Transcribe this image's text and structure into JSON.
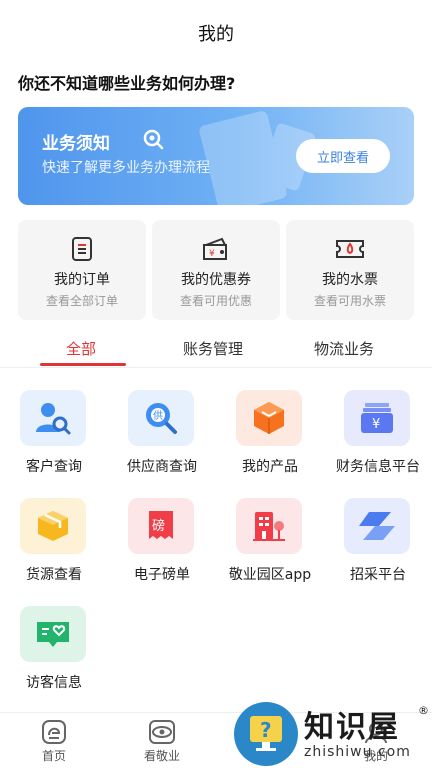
{
  "header": {
    "title": "我的"
  },
  "question": "你还不知道哪些业务如何办理?",
  "banner": {
    "title": "业务须知",
    "subtitle": "快速了解更多业务办理流程",
    "button_label": "立即查看",
    "gradient_start": "#4f95ec",
    "gradient_end": "#a9d0f7"
  },
  "cards": [
    {
      "title": "我的订单",
      "subtitle": "查看全部订单",
      "icon": "order-icon"
    },
    {
      "title": "我的优惠券",
      "subtitle": "查看可用优惠",
      "icon": "coupon-icon"
    },
    {
      "title": "我的水票",
      "subtitle": "查看可用水票",
      "icon": "water-ticket-icon"
    }
  ],
  "tabs": [
    {
      "label": "全部",
      "active": true
    },
    {
      "label": "账务管理",
      "active": false
    },
    {
      "label": "物流业务",
      "active": false
    }
  ],
  "accent_color": "#e23434",
  "services": [
    {
      "label": "客户查询",
      "icon": "customer-search-icon",
      "color": "#3d8ef0"
    },
    {
      "label": "供应商查询",
      "icon": "supplier-search-icon",
      "color": "#3d8ef0"
    },
    {
      "label": "我的产品",
      "icon": "product-cube-icon",
      "color": "#f6721e"
    },
    {
      "label": "财务信息平台",
      "icon": "finance-icon",
      "color": "#5b78f0"
    },
    {
      "label": "货源查看",
      "icon": "goods-box-icon",
      "color": "#f6b81e"
    },
    {
      "label": "电子磅单",
      "icon": "weighbill-icon",
      "color": "#ef3e47"
    },
    {
      "label": "敬业园区app",
      "icon": "park-building-icon",
      "color": "#ef3e47"
    },
    {
      "label": "招采平台",
      "icon": "procurement-icon",
      "color": "#4a7cf0"
    },
    {
      "label": "访客信息",
      "icon": "visitor-icon",
      "color": "#22b46a"
    }
  ],
  "bottom_nav": [
    {
      "label": "首页",
      "icon": "home-icon"
    },
    {
      "label": "看敬业",
      "icon": "view-icon"
    },
    {
      "label": "我的",
      "icon": "profile-icon"
    }
  ],
  "watermark": {
    "text": "知识屋",
    "reg": "®",
    "url": "zhishiwu.com"
  }
}
